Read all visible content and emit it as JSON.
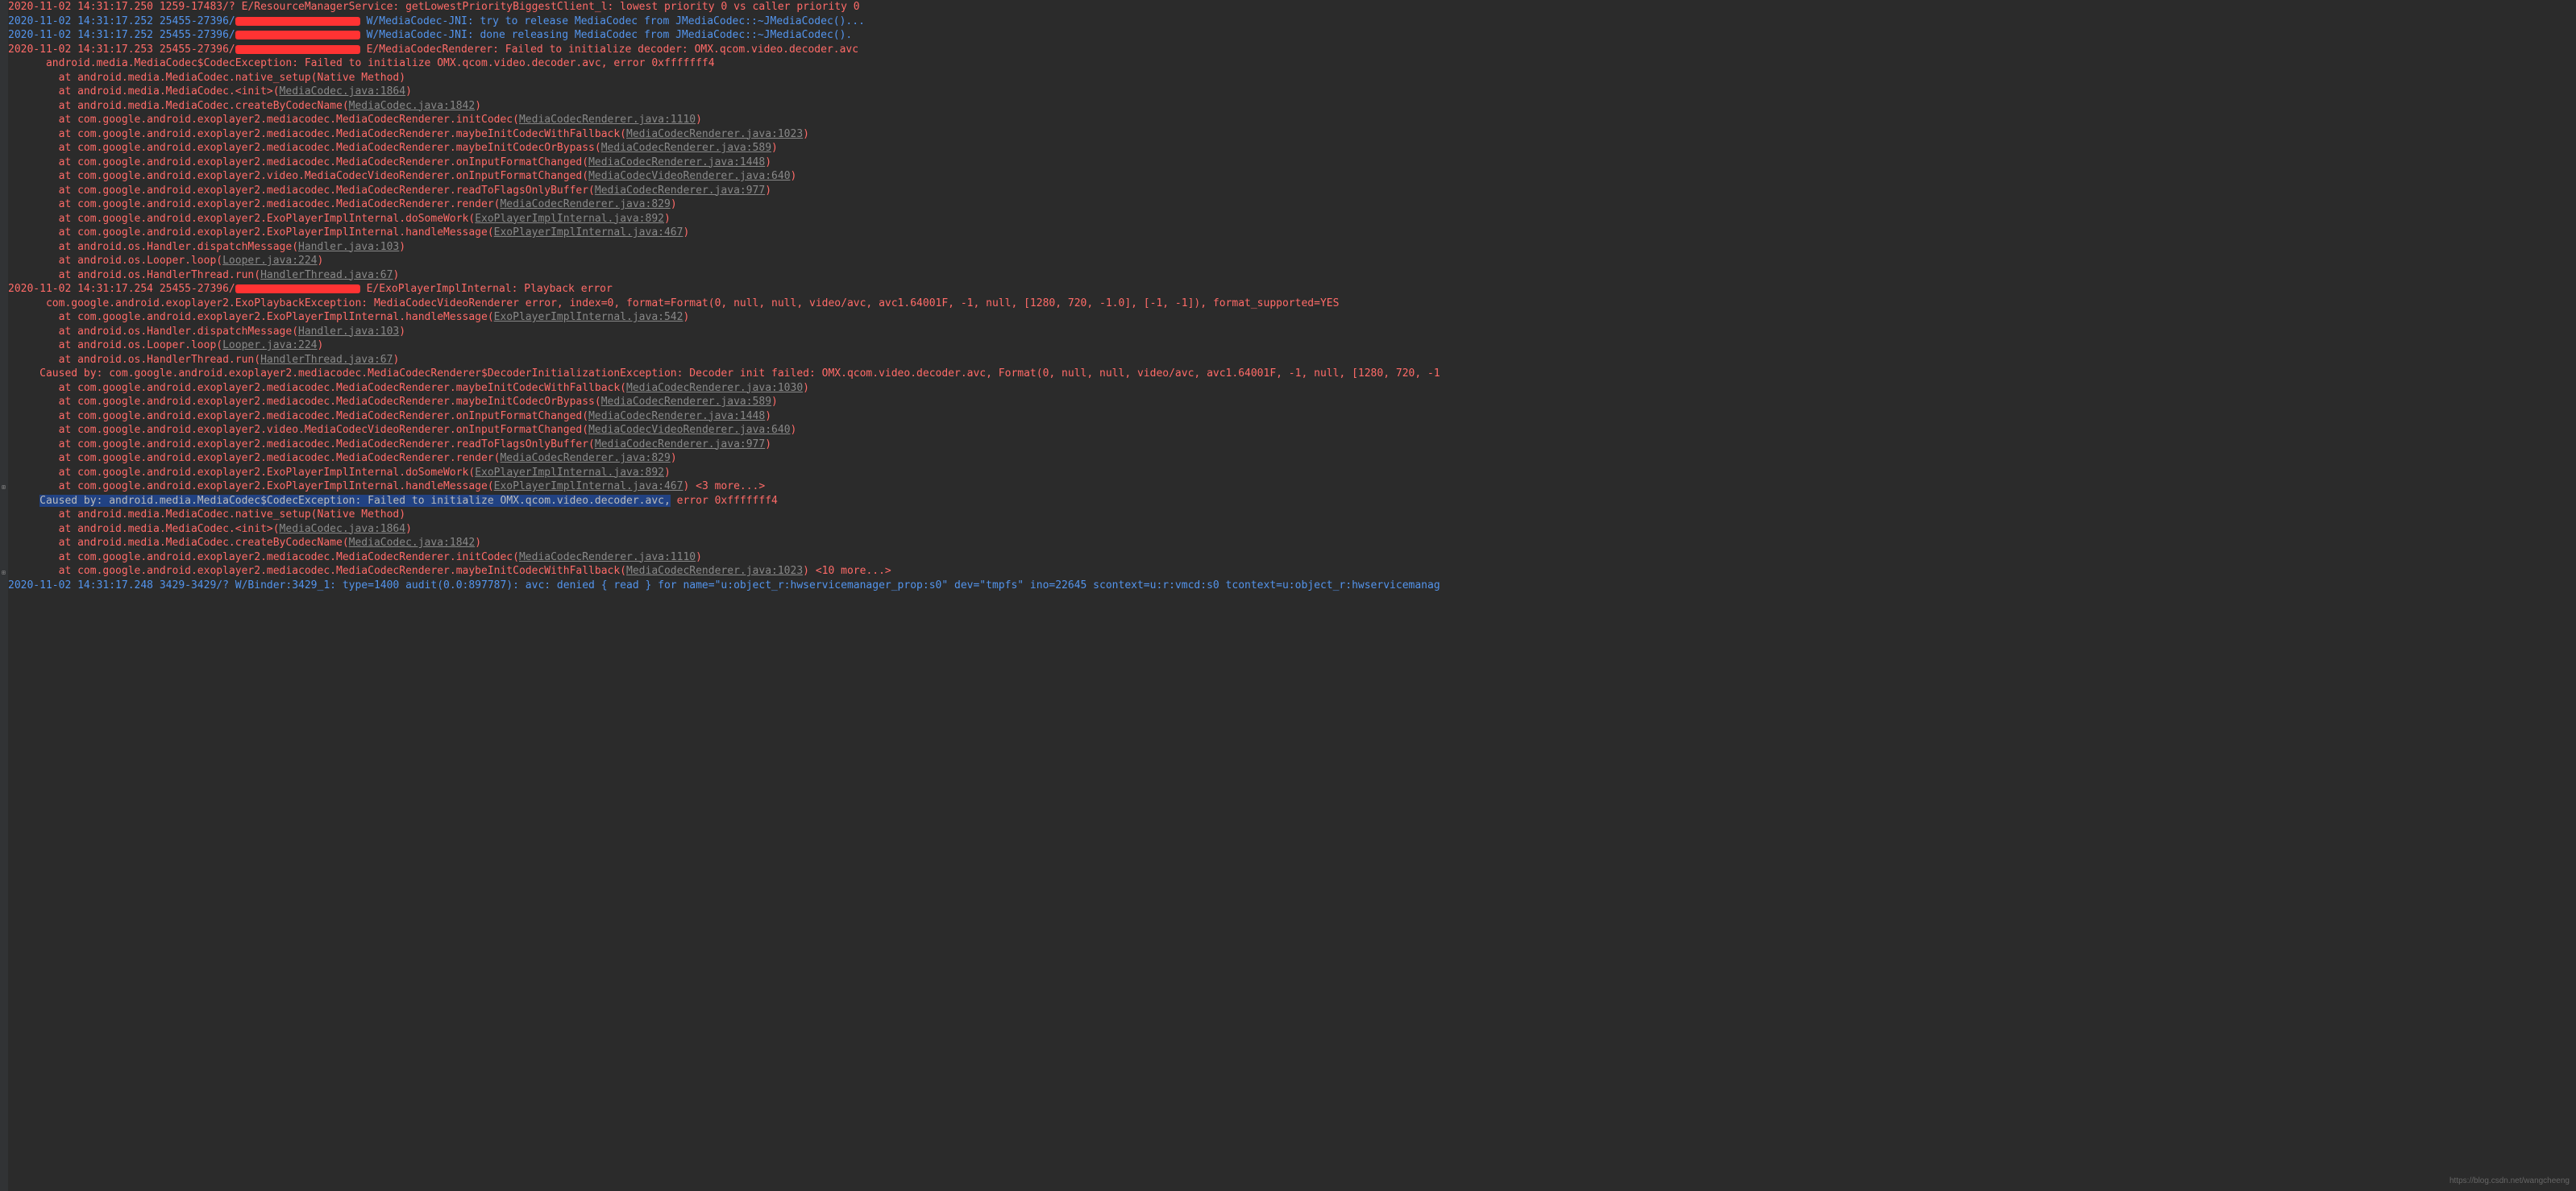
{
  "lines": [
    {
      "type": "error",
      "prefix": "2020-11-02 14:31:17.250 1259-17483/? E/ResourceManagerService: getLowestPriorityBiggestClient_l: lowest priority 0 vs caller priority 0"
    },
    {
      "type": "warning",
      "prefix": "2020-11-02 14:31:17.252 25455-27396/",
      "redacted": "red-w1",
      "suffix": " W/MediaCodec-JNI: try to release MediaCodec from JMediaCodec::~JMediaCodec()..."
    },
    {
      "type": "warning",
      "prefix": "2020-11-02 14:31:17.252 25455-27396/",
      "redacted": "red-w1",
      "suffix": " W/MediaCodec-JNI: done releasing MediaCodec from JMediaCodec::~JMediaCodec()."
    },
    {
      "type": "error",
      "prefix": "2020-11-02 14:31:17.253 25455-27396/",
      "redacted": "red-w2",
      "suffix": " E/MediaCodecRenderer: Failed to initialize decoder: OMX.qcom.video.decoder.avc"
    },
    {
      "type": "error",
      "prefix": "      android.media.MediaCodec$CodecException: Failed to initialize OMX.qcom.video.decoder.avc, error 0xfffffff4"
    },
    {
      "type": "error",
      "prefix": "        at android.media.MediaCodec.native_setup(Native Method)"
    },
    {
      "type": "error",
      "prefix": "        at android.media.MediaCodec.<init>(",
      "link": "MediaCodec.java:1864",
      "suffix": ")"
    },
    {
      "type": "error",
      "prefix": "        at android.media.MediaCodec.createByCodecName(",
      "link": "MediaCodec.java:1842",
      "suffix": ")"
    },
    {
      "type": "error",
      "prefix": "        at com.google.android.exoplayer2.mediacodec.MediaCodecRenderer.initCodec(",
      "link": "MediaCodecRenderer.java:1110",
      "suffix": ")"
    },
    {
      "type": "error",
      "prefix": "        at com.google.android.exoplayer2.mediacodec.MediaCodecRenderer.maybeInitCodecWithFallback(",
      "link": "MediaCodecRenderer.java:1023",
      "suffix": ")"
    },
    {
      "type": "error",
      "prefix": "        at com.google.android.exoplayer2.mediacodec.MediaCodecRenderer.maybeInitCodecOrBypass(",
      "link": "MediaCodecRenderer.java:589",
      "suffix": ")"
    },
    {
      "type": "error",
      "prefix": "        at com.google.android.exoplayer2.mediacodec.MediaCodecRenderer.onInputFormatChanged(",
      "link": "MediaCodecRenderer.java:1448",
      "suffix": ")"
    },
    {
      "type": "error",
      "prefix": "        at com.google.android.exoplayer2.video.MediaCodecVideoRenderer.onInputFormatChanged(",
      "link": "MediaCodecVideoRenderer.java:640",
      "suffix": ")"
    },
    {
      "type": "error",
      "prefix": "        at com.google.android.exoplayer2.mediacodec.MediaCodecRenderer.readToFlagsOnlyBuffer(",
      "link": "MediaCodecRenderer.java:977",
      "suffix": ")"
    },
    {
      "type": "error",
      "prefix": "        at com.google.android.exoplayer2.mediacodec.MediaCodecRenderer.render(",
      "link": "MediaCodecRenderer.java:829",
      "suffix": ")"
    },
    {
      "type": "error",
      "prefix": "        at com.google.android.exoplayer2.ExoPlayerImplInternal.doSomeWork(",
      "link": "ExoPlayerImplInternal.java:892",
      "suffix": ")"
    },
    {
      "type": "error",
      "prefix": "        at com.google.android.exoplayer2.ExoPlayerImplInternal.handleMessage(",
      "link": "ExoPlayerImplInternal.java:467",
      "suffix": ")"
    },
    {
      "type": "error",
      "prefix": "        at android.os.Handler.dispatchMessage(",
      "link": "Handler.java:103",
      "suffix": ")"
    },
    {
      "type": "error",
      "prefix": "        at android.os.Looper.loop(",
      "link": "Looper.java:224",
      "suffix": ")"
    },
    {
      "type": "error",
      "prefix": "        at android.os.HandlerThread.run(",
      "link": "HandlerThread.java:67",
      "suffix": ")"
    },
    {
      "type": "error",
      "prefix": "2020-11-02 14:31:17.254 25455-27396/",
      "redacted": "red-w2",
      "suffix": " E/ExoPlayerImplInternal: Playback error"
    },
    {
      "type": "error",
      "prefix": "      com.google.android.exoplayer2.ExoPlaybackException: MediaCodecVideoRenderer error, index=0, format=Format(0, null, null, video/avc, avc1.64001F, -1, null, [1280, 720, -1.0], [-1, -1]), format_supported=YES"
    },
    {
      "type": "error",
      "prefix": "        at com.google.android.exoplayer2.ExoPlayerImplInternal.handleMessage(",
      "link": "ExoPlayerImplInternal.java:542",
      "suffix": ")"
    },
    {
      "type": "error",
      "prefix": "        at android.os.Handler.dispatchMessage(",
      "link": "Handler.java:103",
      "suffix": ")"
    },
    {
      "type": "error",
      "prefix": "        at android.os.Looper.loop(",
      "link": "Looper.java:224",
      "suffix": ")"
    },
    {
      "type": "error",
      "prefix": "        at android.os.HandlerThread.run(",
      "link": "HandlerThread.java:67",
      "suffix": ")"
    },
    {
      "type": "error",
      "prefix": "     Caused by: com.google.android.exoplayer2.mediacodec.MediaCodecRenderer$DecoderInitializationException: Decoder init failed: OMX.qcom.video.decoder.avc, Format(0, null, null, video/avc, avc1.64001F, -1, null, [1280, 720, -1"
    },
    {
      "type": "error",
      "prefix": "        at com.google.android.exoplayer2.mediacodec.MediaCodecRenderer.maybeInitCodecWithFallback(",
      "link": "MediaCodecRenderer.java:1030",
      "suffix": ")"
    },
    {
      "type": "error",
      "prefix": "        at com.google.android.exoplayer2.mediacodec.MediaCodecRenderer.maybeInitCodecOrBypass(",
      "link": "MediaCodecRenderer.java:589",
      "suffix": ")"
    },
    {
      "type": "error",
      "prefix": "        at com.google.android.exoplayer2.mediacodec.MediaCodecRenderer.onInputFormatChanged(",
      "link": "MediaCodecRenderer.java:1448",
      "suffix": ")"
    },
    {
      "type": "error",
      "prefix": "        at com.google.android.exoplayer2.video.MediaCodecVideoRenderer.onInputFormatChanged(",
      "link": "MediaCodecVideoRenderer.java:640",
      "suffix": ")"
    },
    {
      "type": "error",
      "prefix": "        at com.google.android.exoplayer2.mediacodec.MediaCodecRenderer.readToFlagsOnlyBuffer(",
      "link": "MediaCodecRenderer.java:977",
      "suffix": ")"
    },
    {
      "type": "error",
      "prefix": "        at com.google.android.exoplayer2.mediacodec.MediaCodecRenderer.render(",
      "link": "MediaCodecRenderer.java:829",
      "suffix": ")"
    },
    {
      "type": "error",
      "prefix": "        at com.google.android.exoplayer2.ExoPlayerImplInternal.doSomeWork(",
      "link": "ExoPlayerImplInternal.java:892",
      "suffix": ")"
    },
    {
      "type": "error",
      "prefix": "        at com.google.android.exoplayer2.ExoPlayerImplInternal.handleMessage(",
      "link": "ExoPlayerImplInternal.java:467",
      "suffix": ") <3 more...>"
    },
    {
      "type": "error-hl",
      "prefix": "     ",
      "hl": "Caused by: android.media.MediaCodec$CodecException: Failed to initialize OMX.qcom.video.decoder.avc,",
      "suffix": " error 0xfffffff4"
    },
    {
      "type": "error",
      "prefix": "        at android.media.MediaCodec.native_setup(Native Method)"
    },
    {
      "type": "error",
      "prefix": "        at android.media.MediaCodec.<init>(",
      "link": "MediaCodec.java:1864",
      "suffix": ")"
    },
    {
      "type": "error",
      "prefix": "        at android.media.MediaCodec.createByCodecName(",
      "link": "MediaCodec.java:1842",
      "suffix": ")"
    },
    {
      "type": "error",
      "prefix": "        at com.google.android.exoplayer2.mediacodec.MediaCodecRenderer.initCodec(",
      "link": "MediaCodecRenderer.java:1110",
      "suffix": ")"
    },
    {
      "type": "error",
      "prefix": "        at com.google.android.exoplayer2.mediacodec.MediaCodecRenderer.maybeInitCodecWithFallback(",
      "link": "MediaCodecRenderer.java:1023",
      "suffix": ") <10 more...>"
    },
    {
      "type": "warning",
      "prefix": "2020-11-02 14:31:17.248 3429-3429/? W/Binder:3429_1: type=1400 audit(0.0:897787): avc: denied { read } for name=\"u:object_r:hwservicemanager_prop:s0\" dev=\"tmpfs\" ino=22645 scontext=u:r:vmcd:s0 tcontext=u:object_r:hwservicemanag"
    }
  ],
  "watermark": "https://blog.csdn.net/wangcheeng",
  "gutter_marks": [
    "⊞",
    "⊞"
  ]
}
